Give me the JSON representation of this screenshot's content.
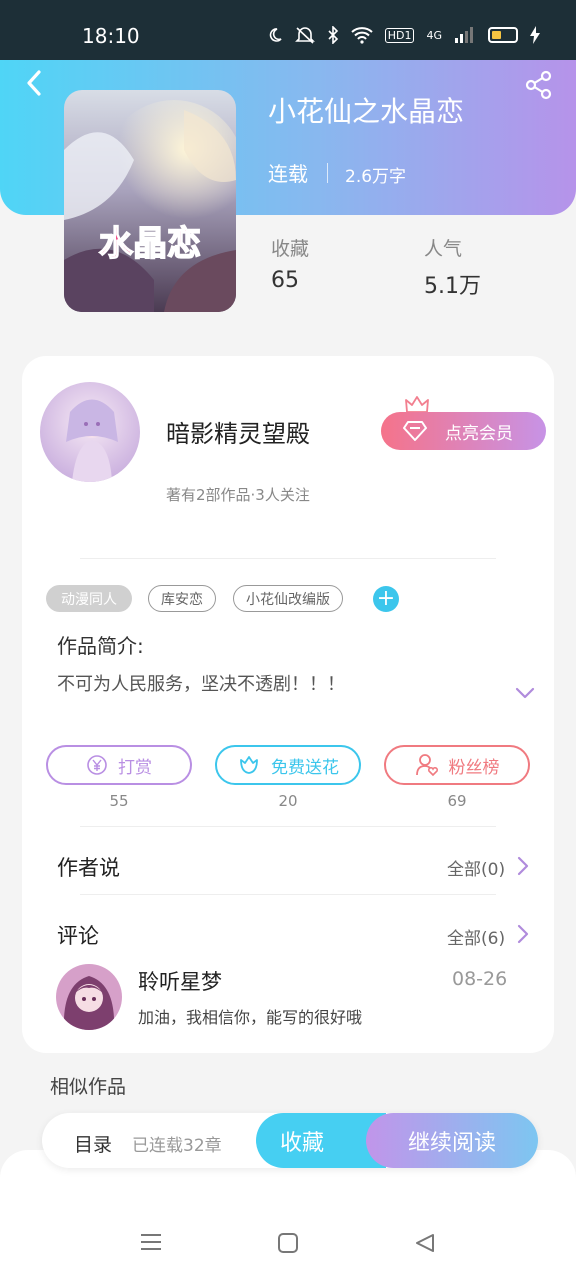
{
  "status_bar": {
    "time": "18:10",
    "network": "4G",
    "hd": "HD1"
  },
  "book": {
    "title": "小花仙之水晶恋",
    "status": "连载",
    "word_count": "2.6万字",
    "cover_text": "水晶恋",
    "stats": [
      {
        "label": "收藏",
        "value": "65"
      },
      {
        "label": "人气",
        "value": "5.1万"
      }
    ]
  },
  "author": {
    "name": "暗影精灵望殿",
    "meta": "著有2部作品·3人关注",
    "vip_button": "点亮会员"
  },
  "tags": [
    "动漫同人",
    "库安恋",
    "小花仙改编版"
  ],
  "intro": {
    "title": "作品简介:",
    "text": "不可为人民服务，坚决不透剧！！！"
  },
  "actions": [
    {
      "label": "打赏",
      "count": "55",
      "color": "#b98fe3",
      "icon": "yen-icon"
    },
    {
      "label": "免费送花",
      "count": "20",
      "color": "#3cc6ec",
      "icon": "flower-icon"
    },
    {
      "label": "粉丝榜",
      "count": "69",
      "color": "#f07a80",
      "icon": "fan-icon"
    }
  ],
  "author_say": {
    "title": "作者说",
    "link": "全部(0)"
  },
  "comments": {
    "title": "评论",
    "link": "全部(6)",
    "items": [
      {
        "user": "聆听星梦",
        "date": "08-26",
        "text": "加油，我相信你，能写的很好哦"
      }
    ]
  },
  "similar": {
    "title": "相似作品"
  },
  "bottom_bar": {
    "toc_label": "目录",
    "toc_count": "已连载32章",
    "favorite": "收藏",
    "continue_reading": "继续阅读"
  },
  "colors": {
    "header_start": "#4fd5f6",
    "header_end": "#b693ea",
    "accent_blue": "#46cff2",
    "vip_pink": "#f5738a"
  }
}
